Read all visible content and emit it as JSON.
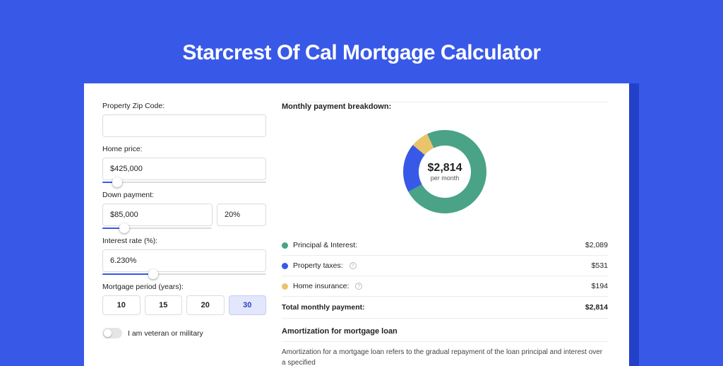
{
  "title": "Starcrest Of Cal Mortgage Calculator",
  "left": {
    "zip_label": "Property Zip Code:",
    "zip_value": "",
    "home_price_label": "Home price:",
    "home_price_value": "$425,000",
    "home_price_slider_pct": 9,
    "down_payment_label": "Down payment:",
    "down_payment_value": "$85,000",
    "down_payment_pct_value": "20%",
    "down_payment_slider_pct": 20,
    "interest_label": "Interest rate (%):",
    "interest_value": "6.230%",
    "interest_slider_pct": 31,
    "period_label": "Mortgage period (years):",
    "periods": [
      "10",
      "15",
      "20",
      "30"
    ],
    "active_period": "30",
    "veteran_label": "I am veteran or military"
  },
  "right": {
    "breakdown_title": "Monthly payment breakdown:",
    "donut": {
      "amount": "$2,814",
      "sub": "per month",
      "slices": [
        {
          "color": "#4aa387",
          "pct": 74
        },
        {
          "color": "#3859e8",
          "pct": 19
        },
        {
          "color": "#e9c46a",
          "pct": 7
        }
      ]
    },
    "items": [
      {
        "color": "green",
        "label": "Principal & Interest:",
        "help": false,
        "value": "$2,089"
      },
      {
        "color": "blue",
        "label": "Property taxes:",
        "help": true,
        "value": "$531"
      },
      {
        "color": "yellow",
        "label": "Home insurance:",
        "help": true,
        "value": "$194"
      }
    ],
    "total_label": "Total monthly payment:",
    "total_value": "$2,814",
    "amort_title": "Amortization for mortgage loan",
    "amort_body": "Amortization for a mortgage loan refers to the gradual repayment of the loan principal and interest over a specified"
  }
}
